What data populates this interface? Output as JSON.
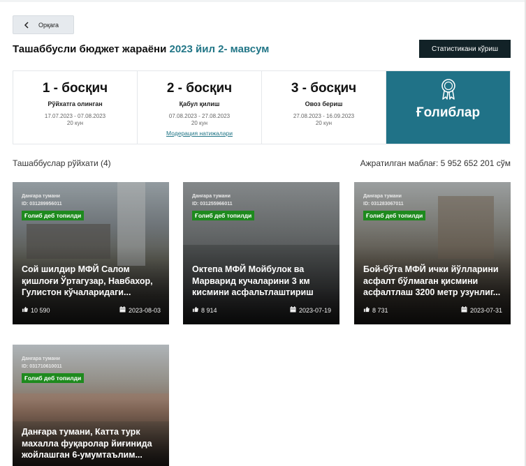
{
  "colors": {
    "accent": "#227687",
    "dark_button": "#122227",
    "winners_bg": "#207287",
    "badge_green": "#1e8a1e"
  },
  "nav": {
    "back_label": "Орқага",
    "back_icon": "chevron-left-icon"
  },
  "header": {
    "title_prefix": "Ташаббусли бюджет жараёни",
    "title_accent": "2023 йил 2- мавсум",
    "stats_button": "Статистикани кўриш"
  },
  "stages": [
    {
      "num": "1 - босқич",
      "name": "Рўйхатга олинган",
      "dates": "17.07.2023 - 07.08.2023",
      "days": "20 кун"
    },
    {
      "num": "2 - босқич",
      "name": "Қабул қилиш",
      "dates": "07.08.2023 - 27.08.2023",
      "days": "20 кун",
      "link": "Модерация натижалари"
    },
    {
      "num": "3 - босқич",
      "name": "Овоз бериш",
      "dates": "27.08.2023 - 16.09.2023",
      "days": "20 кун"
    }
  ],
  "winners": {
    "label": "Ғолиблар",
    "icon": "award-medal-icon"
  },
  "list": {
    "title": "Ташаббуслар рўйхати (4)",
    "budget": "Ажратилган маблағ: 5 952 652 201 сўм"
  },
  "cards": [
    {
      "district": "Данғара тумани",
      "id": "ID: 031289956011",
      "badge": "Ғолиб деб топилди",
      "title": "Сой шилдир МФЙ Салом қишлоғи Ўртагузар, Навбахор, Гулистон кўчаларидаги...",
      "votes": "10 590",
      "date": "2023-08-03"
    },
    {
      "district": "Данғара тумани",
      "id": "ID: 031255966011",
      "badge": "Ғолиб деб топилди",
      "title": "Октепа МФЙ Мойбулок ва Марварид кучаларини 3 км кисмини асфальтлаштириш",
      "votes": "8 914",
      "date": "2023-07-19"
    },
    {
      "district": "Данғара тумани",
      "id": "ID: 031283067011",
      "badge": "Ғолиб деб топилди",
      "title": "Бой-бўта МФЙ ички йўлларини асфалт бўлмаган қисмини асфалтлаш 3200 метр узунлиг...",
      "votes": "8 731",
      "date": "2023-07-31"
    },
    {
      "district": "Данғара тумани",
      "id": "ID: 031710610011",
      "badge": "Ғолиб деб топилди",
      "title": "Данғара тумани, Катта турк махалла фуқаролар йиғинида жойлашган 6-умумтаълим...",
      "votes": "",
      "date": ""
    }
  ]
}
